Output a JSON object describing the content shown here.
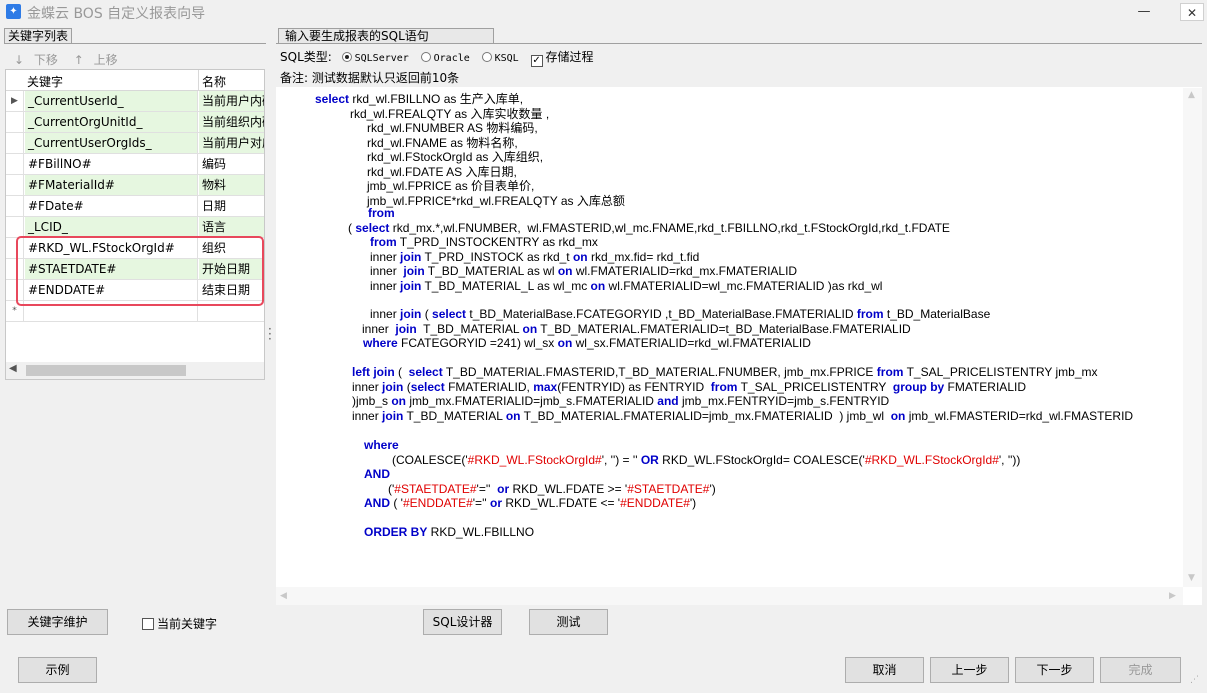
{
  "window": {
    "title": "金蝶云 BOS 自定义报表向导",
    "min_icon": "minimize-icon",
    "max_icon": "maximize-icon",
    "close_icon": "close-icon"
  },
  "left_panel": {
    "tab_label": "关键字列表",
    "move_down_label": "下移",
    "move_up_label": "上移",
    "columns": {
      "key": "关键字",
      "name": "名称"
    },
    "rows": [
      {
        "key": "_CurrentUserId_",
        "name": "当前用户内码",
        "green": true,
        "current": true
      },
      {
        "key": "_CurrentOrgUnitId_",
        "name": "当前组织内码",
        "green": true
      },
      {
        "key": "_CurrentUserOrgIds_",
        "name": "当前用户对应组织",
        "green": true
      },
      {
        "key": "#FBillNO#",
        "name": "编码",
        "green": false
      },
      {
        "key": "#FMaterialId#",
        "name": "物料",
        "green": true
      },
      {
        "key": "#FDate#",
        "name": "日期",
        "green": false
      },
      {
        "key": "_LCID_",
        "name": "语言",
        "green": true
      },
      {
        "key": "#RKD_WL.FStockOrgId#",
        "name": "组织",
        "green": false
      },
      {
        "key": "#STAETDATE#",
        "name": "开始日期",
        "green": true
      },
      {
        "key": "#ENDDATE#",
        "name": "结束日期",
        "green": false
      }
    ],
    "new_row_marker": "*",
    "current_row_marker": "▶"
  },
  "right_panel": {
    "tab_label": "输入要生成报表的SQL语句",
    "sql_type_label": "SQL类型:",
    "sql_types": [
      "SQLServer",
      "Oracle",
      "KSQL"
    ],
    "selected_sql_type": "SQLServer",
    "stored_proc_label": "存储过程",
    "stored_proc_checked": true,
    "note": "备注: 测试数据默认只返回前10条"
  },
  "sql_lines": [
    [
      {
        "t": "select",
        "k": "kw"
      },
      {
        "t": " rkd_wl.FBILLNO as 生产入库单,"
      }
    ],
    [
      {
        "t": "rkd_wl.FREALQTY as 入库实收数量 ,"
      }
    ],
    [
      {
        "t": "rkd_wl.FNUMBER AS 物料编码,"
      }
    ],
    [
      {
        "t": "rkd_wl.FNAME as 物料名称,"
      }
    ],
    [
      {
        "t": "rkd_wl.FStockOrgId as 入库组织,"
      }
    ],
    [
      {
        "t": "rkd_wl.FDATE AS 入库日期,"
      }
    ],
    [
      {
        "t": "jmb_wl.FPRICE as 价目表单价,"
      }
    ],
    [
      {
        "t": "jmb_wl.FPRICE*rkd_wl.FREALQTY as 入库总额"
      }
    ],
    [
      {
        "t": "from",
        "k": "kw"
      }
    ],
    [
      {
        "t": "( "
      },
      {
        "t": "select",
        "k": "kw"
      },
      {
        "t": " rkd_mx.*,wl.FNUMBER,  wl.FMASTERID,wl_mc.FNAME,rkd_t.FBILLNO,rkd_t.FStockOrgId,rkd_t.FDATE"
      }
    ],
    [
      {
        "t": "from",
        "k": "kw"
      },
      {
        "t": " T_PRD_INSTOCKENTRY as rkd_mx"
      }
    ],
    [
      {
        "t": "inner "
      },
      {
        "t": "join",
        "k": "kw"
      },
      {
        "t": " T_PRD_INSTOCK as rkd_t "
      },
      {
        "t": "on",
        "k": "kw"
      },
      {
        "t": " rkd_mx.fid= rkd_t.fid"
      }
    ],
    [
      {
        "t": "inner  "
      },
      {
        "t": "join",
        "k": "kw"
      },
      {
        "t": " T_BD_MATERIAL as wl "
      },
      {
        "t": "on",
        "k": "kw"
      },
      {
        "t": " wl.FMATERIALID=rkd_mx.FMATERIALID"
      }
    ],
    [
      {
        "t": "inner "
      },
      {
        "t": "join",
        "k": "kw"
      },
      {
        "t": " T_BD_MATERIAL_L as wl_mc "
      },
      {
        "t": "on",
        "k": "kw"
      },
      {
        "t": " wl.FMATERIALID=wl_mc.FMATERIALID )as rkd_wl"
      }
    ],
    [
      {
        "t": "inner "
      },
      {
        "t": "join",
        "k": "kw"
      },
      {
        "t": " ( "
      },
      {
        "t": "select",
        "k": "kw"
      },
      {
        "t": " t_BD_MaterialBase.FCATEGORYID ,t_BD_MaterialBase.FMATERIALID "
      },
      {
        "t": "from",
        "k": "kw"
      },
      {
        "t": " t_BD_MaterialBase"
      }
    ],
    [
      {
        "t": "inner  "
      },
      {
        "t": "join",
        "k": "kw"
      },
      {
        "t": "  T_BD_MATERIAL "
      },
      {
        "t": "on",
        "k": "kw"
      },
      {
        "t": " T_BD_MATERIAL.FMATERIALID=t_BD_MaterialBase.FMATERIALID"
      }
    ],
    [
      {
        "t": "where",
        "k": "kw"
      },
      {
        "t": " FCATEGORYID =241) wl_sx "
      },
      {
        "t": "on",
        "k": "kw"
      },
      {
        "t": " wl_sx.FMATERIALID=rkd_wl.FMATERIALID"
      }
    ],
    [
      {
        "t": "left join",
        "k": "kw"
      },
      {
        "t": " (  "
      },
      {
        "t": "select",
        "k": "kw"
      },
      {
        "t": " T_BD_MATERIAL.FMASTERID,T_BD_MATERIAL.FNUMBER, jmb_mx.FPRICE "
      },
      {
        "t": "from",
        "k": "kw"
      },
      {
        "t": " T_SAL_PRICELISTENTRY jmb_mx"
      }
    ],
    [
      {
        "t": "inner "
      },
      {
        "t": "join",
        "k": "kw"
      },
      {
        "t": " ("
      },
      {
        "t": "select",
        "k": "kw"
      },
      {
        "t": " FMATERIALID, "
      },
      {
        "t": "max",
        "k": "kw"
      },
      {
        "t": "(FENTRYID) as FENTRYID  "
      },
      {
        "t": "from",
        "k": "kw"
      },
      {
        "t": " T_SAL_PRICELISTENTRY  "
      },
      {
        "t": "group by",
        "k": "kw"
      },
      {
        "t": " FMATERIALID"
      }
    ],
    [
      {
        "t": ")jmb_s "
      },
      {
        "t": "on",
        "k": "kw"
      },
      {
        "t": " jmb_mx.FMATERIALID=jmb_s.FMATERIALID "
      },
      {
        "t": "and",
        "k": "kw"
      },
      {
        "t": " jmb_mx.FENTRYID=jmb_s.FENTRYID"
      }
    ],
    [
      {
        "t": "inner "
      },
      {
        "t": "join",
        "k": "kw"
      },
      {
        "t": " T_BD_MATERIAL "
      },
      {
        "t": "on",
        "k": "kw"
      },
      {
        "t": " T_BD_MATERIAL.FMATERIALID=jmb_mx.FMATERIALID  ) jmb_wl  "
      },
      {
        "t": "on",
        "k": "kw"
      },
      {
        "t": " jmb_wl.FMASTERID=rkd_wl.FMASTERID"
      }
    ],
    [
      {
        "t": "where",
        "k": "kw"
      }
    ],
    [
      {
        "t": "(COALESCE('"
      },
      {
        "t": "#RKD_WL.FStockOrgId#",
        "k": "st"
      },
      {
        "t": "', '') = '' "
      },
      {
        "t": "OR",
        "k": "kw"
      },
      {
        "t": " RKD_WL.FStockOrgId= COALESCE('"
      },
      {
        "t": "#RKD_WL.FStockOrgId#",
        "k": "st"
      },
      {
        "t": "', ''))"
      }
    ],
    [
      {
        "t": "AND",
        "k": "kw"
      }
    ],
    [
      {
        "t": "('"
      },
      {
        "t": "#STAETDATE#",
        "k": "st"
      },
      {
        "t": "'=''  "
      },
      {
        "t": "or",
        "k": "kw"
      },
      {
        "t": " RKD_WL.FDATE >= '"
      },
      {
        "t": "#STAETDATE#",
        "k": "st"
      },
      {
        "t": "')"
      }
    ],
    [
      {
        "t": "AND",
        "k": "kw"
      },
      {
        "t": " ( '"
      },
      {
        "t": "#ENDDATE#",
        "k": "st"
      },
      {
        "t": "'='' "
      },
      {
        "t": "or",
        "k": "kw"
      },
      {
        "t": " RKD_WL.FDATE <= '"
      },
      {
        "t": "#ENDDATE#",
        "k": "st"
      },
      {
        "t": "')"
      }
    ],
    [
      {
        "t": "ORDER BY",
        "k": "kw"
      },
      {
        "t": " RKD_WL.FBILLNO"
      }
    ]
  ],
  "buttons": {
    "keyword_maintain": "关键字维护",
    "current_keyword": "当前关键字",
    "sql_designer": "SQL设计器",
    "test": "测试",
    "example": "示例",
    "cancel": "取消",
    "prev": "上一步",
    "next": "下一步",
    "finish": "完成"
  }
}
